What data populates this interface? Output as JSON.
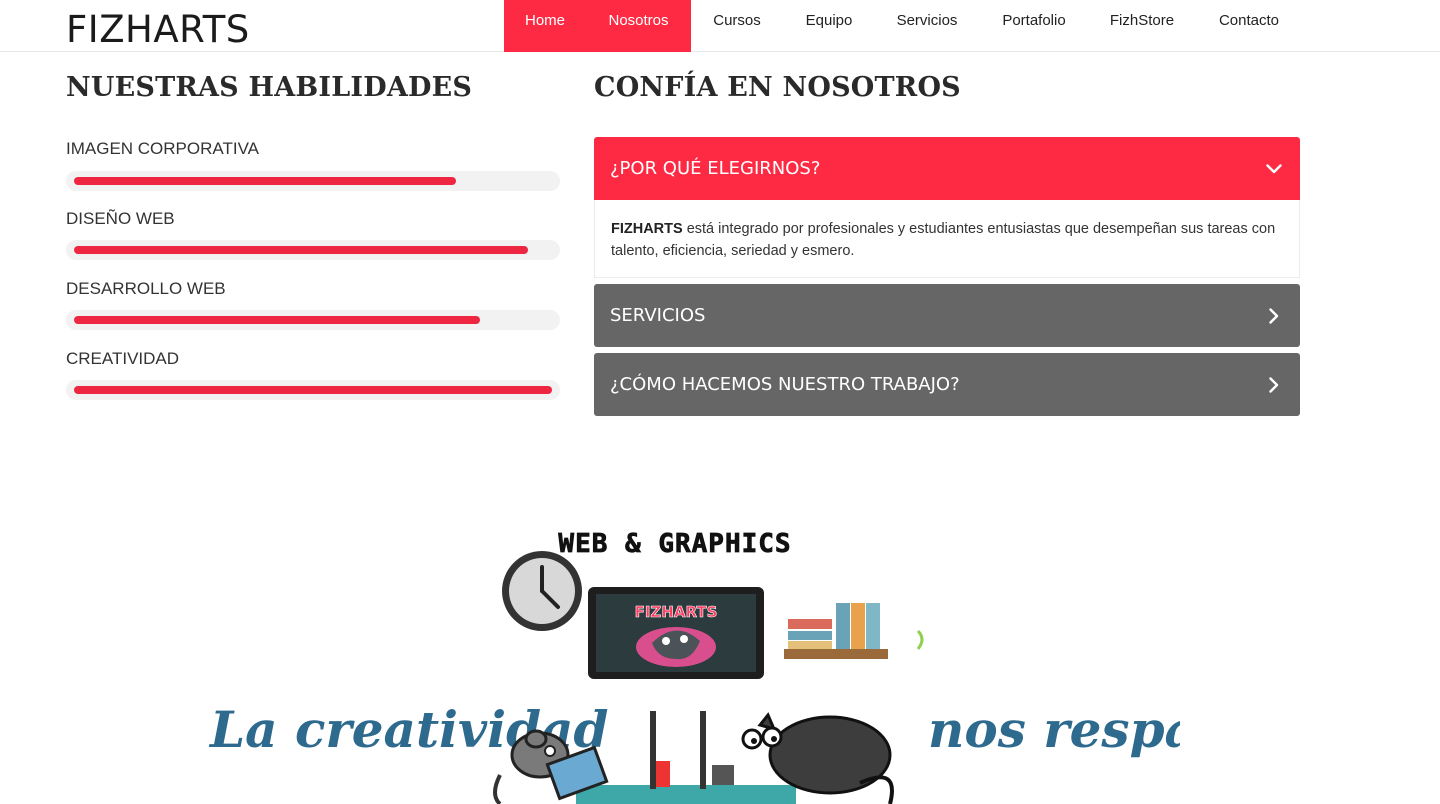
{
  "header": {
    "logo": "FIZHARTS",
    "nav": [
      {
        "label": "Home"
      },
      {
        "label": "Nosotros"
      },
      {
        "label": "Cursos"
      },
      {
        "label": "Equipo"
      },
      {
        "label": "Servicios"
      },
      {
        "label": "Portafolio"
      },
      {
        "label": "FizhStore"
      },
      {
        "label": "Contacto"
      }
    ]
  },
  "skills": {
    "title": "NUESTRAS HABILIDADES",
    "items": [
      {
        "label": "IMAGEN CORPORATIVA",
        "level": 0.8
      },
      {
        "label": "DISEÑO WEB",
        "level": 0.95
      },
      {
        "label": "DESARROLLO WEB",
        "level": 0.85
      },
      {
        "label": "CREATIVIDAD",
        "level": 1.0
      }
    ]
  },
  "trust": {
    "title": "CONFÍA EN NOSOTROS",
    "accordion": [
      {
        "title": "¿POR QUÉ ELEGIRNOS?",
        "expanded": true,
        "body_strong": "FIZHARTS",
        "body_text": " está integrado por profesionales y estudiantes entusiastas que desempeñan sus tareas con talento, eficiencia, seriedad y esmero."
      },
      {
        "title": "SERVICIOS",
        "expanded": false
      },
      {
        "title": "¿CÓMO HACEMOS NUESTRO TRABAJO?",
        "expanded": false
      }
    ]
  },
  "banner": {
    "sign": "WEB & GRAPHICS",
    "screen_logo": "FIZHARTS",
    "slogan_left": "La creatividad",
    "slogan_right": "nos respalda"
  },
  "colors": {
    "accent": "#fe2a43",
    "grey_panel": "#666666",
    "script_blue": "#2d6a8e"
  }
}
